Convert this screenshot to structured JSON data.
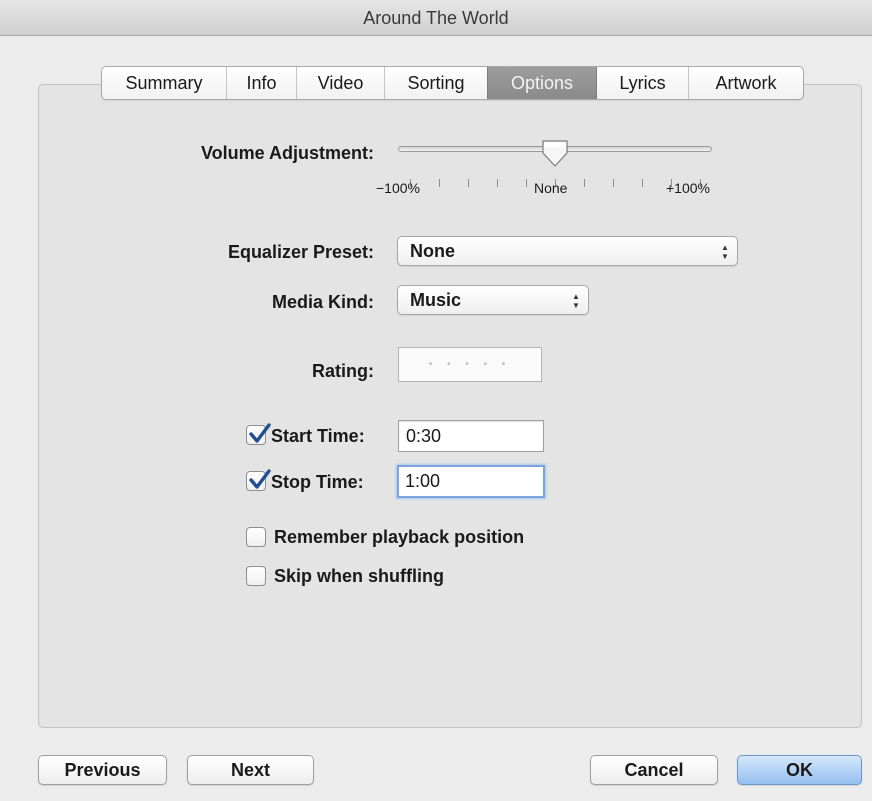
{
  "window": {
    "title": "Around The World"
  },
  "tabs": [
    {
      "label": "Summary",
      "active": false
    },
    {
      "label": "Info",
      "active": false
    },
    {
      "label": "Video",
      "active": false
    },
    {
      "label": "Sorting",
      "active": false
    },
    {
      "label": "Options",
      "active": true
    },
    {
      "label": "Lyrics",
      "active": false
    },
    {
      "label": "Artwork",
      "active": false
    }
  ],
  "volume": {
    "label": "Volume Adjustment:",
    "value_percent": 0,
    "min_label": "−100%",
    "mid_label": "None",
    "max_label": "+100%"
  },
  "equalizer": {
    "label": "Equalizer Preset:",
    "value": "None"
  },
  "media_kind": {
    "label": "Media Kind:",
    "value": "Music"
  },
  "rating": {
    "label": "Rating:",
    "stars": 0,
    "placeholder": "• • • • •"
  },
  "start_time": {
    "label": "Start Time:",
    "checked": true,
    "value": "0:30"
  },
  "stop_time": {
    "label": "Stop Time:",
    "checked": true,
    "value": "1:00"
  },
  "remember_playback": {
    "label": "Remember playback position",
    "checked": false
  },
  "skip_shuffle": {
    "label": "Skip when shuffling",
    "checked": false
  },
  "buttons": {
    "previous": "Previous",
    "next": "Next",
    "cancel": "Cancel",
    "ok": "OK"
  },
  "colors": {
    "active_tab": "#919191",
    "checkmark": "#1f4f8f",
    "default_button": "#95c0ef",
    "focus_ring": "#7aa4dd"
  }
}
